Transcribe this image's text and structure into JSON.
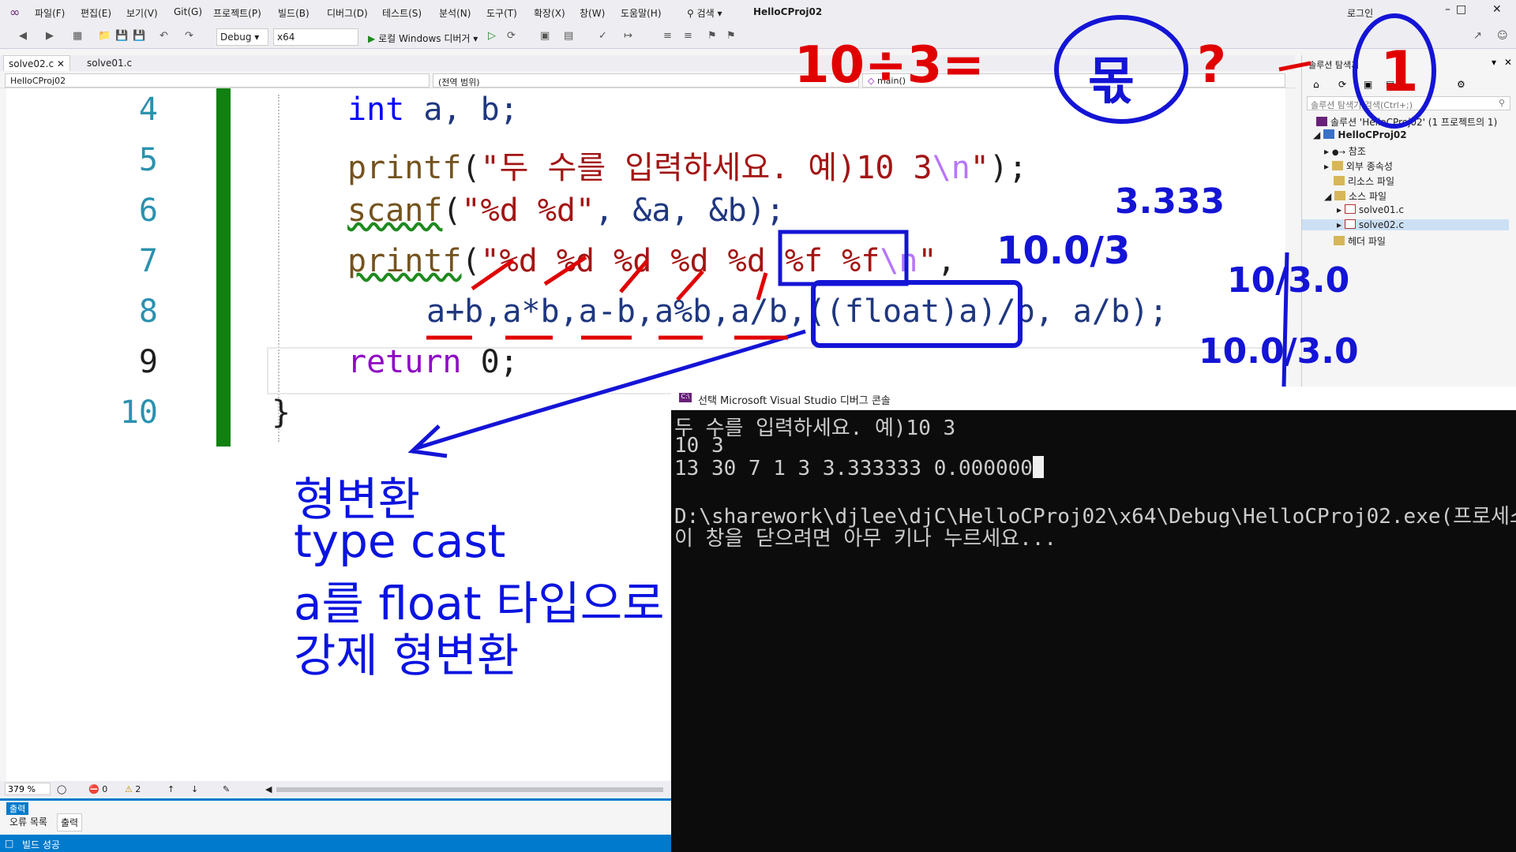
{
  "menubar": {
    "items": [
      "파일(F)",
      "편집(E)",
      "보기(V)",
      "Git(G)",
      "프로젝트(P)",
      "빌드(B)",
      "디버그(D)",
      "테스트(S)",
      "분석(N)",
      "도구(T)",
      "확장(X)",
      "창(W)",
      "도움말(H)"
    ],
    "search_label": "검색",
    "project_name": "HelloCProj02",
    "login_label": "로그인"
  },
  "toolbar": {
    "config": "Debug",
    "platform": "x64",
    "run_label": "로컬 Windows 디버거"
  },
  "tabs": [
    {
      "label": "solve02.c",
      "active": true
    },
    {
      "label": "solve01.c",
      "active": false
    }
  ],
  "navbar": {
    "project": "HelloCProj02",
    "scope": "(전역 범위)",
    "function": "main()"
  },
  "editor": {
    "line_numbers": [
      "4",
      "5",
      "6",
      "7",
      "8",
      "9",
      "10"
    ],
    "lines": {
      "l4_type": "int",
      "l4_rest": " a, b;",
      "l5_fn": "printf",
      "l5_open": "(",
      "l5_str": "\"두 수를 입력하세요. 예)10 3",
      "l5_esc": "\\n",
      "l5_close_q": "\"",
      "l5_end": ");",
      "l6_fn": "scanf",
      "l6_open": "(",
      "l6_str": "\"%d %d\"",
      "l6_args": ", &a, &b);",
      "l7_fn": "printf",
      "l7_open": "(",
      "l7_str": "\"%d %d %d %d %d %f %f",
      "l7_esc": "\\n",
      "l7_close_q": "\"",
      "l7_end": ",",
      "l8": "a+b,a*b,a-b,a%b,a/b,((float)a)/b, a/b);",
      "l9_kw": "return",
      "l9_rest": " 0;",
      "l10": "}"
    },
    "zoom": "379 %",
    "errors": "0",
    "warnings": "2"
  },
  "solution_explorer": {
    "title": "솔루션 탐색기",
    "search_placeholder": "솔루션 탐색기 검색(Ctrl+;)",
    "items": [
      {
        "label": "솔루션 'HelloCProj02' (1 프로젝트의 1)"
      },
      {
        "label": "HelloCProj02"
      },
      {
        "label": "참조"
      },
      {
        "label": "외부 종속성"
      },
      {
        "label": "리소스 파일"
      },
      {
        "label": "소스 파일"
      },
      {
        "label": "solve01.c"
      },
      {
        "label": "solve02.c"
      },
      {
        "label": "헤더 파일"
      }
    ]
  },
  "output_panel": {
    "header": "출력",
    "tabs": [
      "오류 목록",
      "출력"
    ]
  },
  "statusbar": {
    "text": "빌드 성공"
  },
  "console": {
    "title": "선택 Microsoft Visual Studio 디버그 콘솔",
    "lines": [
      "두 수를 입력하세요. 예)10 3",
      "10 3",
      "13 30 7 1 3 3.333333 0.000000",
      "",
      "D:\\sharework\\djlee\\djC\\HelloCProj02\\x64\\Debug\\HelloCProj02.exe(프로세스",
      "이 창을 닫으려면 아무 키나 누르세요..."
    ]
  },
  "annotations": {
    "typed_notes": [
      "형변환",
      "type cast",
      "a를 float 타입으로",
      "강제 형변환"
    ],
    "handwriting": {
      "top_red": "10÷3=",
      "top_blue_circle": "몫",
      "top_red_q": "?",
      "top_blue_one": "1",
      "side_1": "3.333",
      "side_2": "10.0/3",
      "side_3": "10/3.0",
      "side_4": "10.0/3.0"
    },
    "colors": {
      "blue": "#0a14e0",
      "red": "#e00000"
    }
  }
}
